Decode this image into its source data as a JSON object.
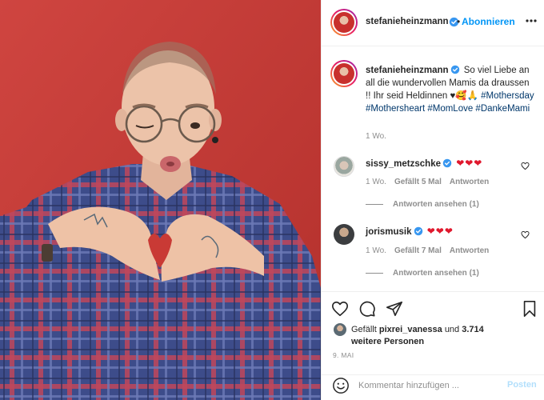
{
  "header": {
    "username": "stefanieheinzmann",
    "follow_label": "Abonnieren",
    "dot": "•"
  },
  "caption": {
    "username": "stefanieheinzmann",
    "text": "So viel Liebe an all die wundervollen Mamis da draussen !! Ihr seid Heldinnen ♥🥰🙏",
    "hashtags": "#Mothersday #Mothersheart #MomLove #DankeMami",
    "time": "1 Wo."
  },
  "comments": [
    {
      "username": "sissy_metzschke",
      "text": "❤❤❤",
      "time": "1 Wo.",
      "likes": "Gefällt 5 Mal",
      "reply_label": "Antworten",
      "view_replies": "Antworten ansehen (1)"
    },
    {
      "username": "jorismusik",
      "text": "❤❤❤",
      "time": "1 Wo.",
      "likes": "Gefällt 7 Mal",
      "reply_label": "Antworten",
      "view_replies": "Antworten ansehen (1)"
    }
  ],
  "likes": {
    "prefix": "Gefällt",
    "user": "pixrei_vanessa",
    "middle": "und",
    "others": "3.714 weitere Personen"
  },
  "post_date": "9. MAI",
  "add_comment": {
    "placeholder": "Kommentar hinzufügen ...",
    "post_label": "Posten"
  },
  "icons": {
    "verified": "verified-badge-icon",
    "more": "more-options-icon",
    "like": "heart-icon",
    "comment": "comment-bubble-icon",
    "share": "paper-plane-icon",
    "save": "bookmark-icon",
    "emoji": "smiley-icon"
  },
  "colors": {
    "accent": "#0095f6",
    "verified": "#3897f0",
    "hashtag": "#00376b",
    "heart_red": "#e0182d",
    "muted": "#8e8e8e",
    "photo_background": "#c93a35"
  }
}
